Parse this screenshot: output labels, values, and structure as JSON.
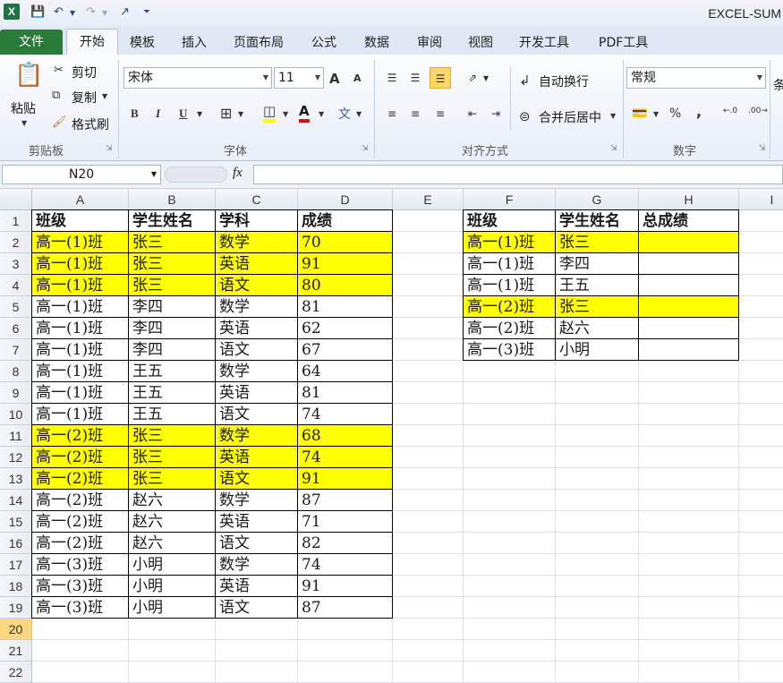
{
  "window": {
    "title": "EXCEL-SUM"
  },
  "tabs": [
    {
      "label": "文件"
    },
    {
      "label": "开始"
    },
    {
      "label": "模板"
    },
    {
      "label": "插入"
    },
    {
      "label": "页面布局"
    },
    {
      "label": "公式"
    },
    {
      "label": "数据"
    },
    {
      "label": "审阅"
    },
    {
      "label": "视图"
    },
    {
      "label": "开发工具"
    },
    {
      "label": "PDF工具"
    }
  ],
  "ribbon": {
    "clipboard": {
      "paste": "粘贴",
      "cut": "剪切",
      "copy": "复制",
      "format_painter": "格式刷",
      "group": "剪贴板"
    },
    "font": {
      "family": "宋体",
      "size": "11",
      "bold": "B",
      "italic": "I",
      "underline": "U",
      "font_color": "A",
      "grow": "A",
      "shrink": "A",
      "group": "字体"
    },
    "alignment": {
      "wrap": "自动换行",
      "merge": "合并后居中",
      "group": "对齐方式"
    },
    "number": {
      "format": "常规",
      "percent": "%",
      "comma": ",",
      "group": "数字",
      "cut_off": "条"
    }
  },
  "formula_bar": {
    "name_box": "N20",
    "fx": "fx",
    "formula": ""
  },
  "columns": [
    "A",
    "B",
    "C",
    "D",
    "E",
    "F",
    "G",
    "H",
    "I"
  ],
  "rows": [
    "1",
    "2",
    "3",
    "4",
    "5",
    "6",
    "7",
    "8",
    "9",
    "10",
    "11",
    "12",
    "13",
    "14",
    "15",
    "16",
    "17",
    "18",
    "19",
    "20",
    "21",
    "22"
  ],
  "selected_row": "20",
  "table_left": {
    "headers": [
      "班级",
      "学生姓名",
      "学科",
      "成绩"
    ],
    "rows": [
      [
        "高一(1)班",
        "张三",
        "数学",
        "70"
      ],
      [
        "高一(1)班",
        "张三",
        "英语",
        "91"
      ],
      [
        "高一(1)班",
        "张三",
        "语文",
        "80"
      ],
      [
        "高一(1)班",
        "李四",
        "数学",
        "81"
      ],
      [
        "高一(1)班",
        "李四",
        "英语",
        "62"
      ],
      [
        "高一(1)班",
        "李四",
        "语文",
        "67"
      ],
      [
        "高一(1)班",
        "王五",
        "数学",
        "64"
      ],
      [
        "高一(1)班",
        "王五",
        "英语",
        "81"
      ],
      [
        "高一(1)班",
        "王五",
        "语文",
        "74"
      ],
      [
        "高一(2)班",
        "张三",
        "数学",
        "68"
      ],
      [
        "高一(2)班",
        "张三",
        "英语",
        "74"
      ],
      [
        "高一(2)班",
        "张三",
        "语文",
        "91"
      ],
      [
        "高一(2)班",
        "赵六",
        "数学",
        "87"
      ],
      [
        "高一(2)班",
        "赵六",
        "英语",
        "71"
      ],
      [
        "高一(2)班",
        "赵六",
        "语文",
        "82"
      ],
      [
        "高一(3)班",
        "小明",
        "数学",
        "74"
      ],
      [
        "高一(3)班",
        "小明",
        "英语",
        "91"
      ],
      [
        "高一(3)班",
        "小明",
        "语文",
        "87"
      ]
    ],
    "highlighted_rows": [
      0,
      1,
      2,
      9,
      10,
      11
    ]
  },
  "table_right": {
    "headers": [
      "班级",
      "学生姓名",
      "总成绩"
    ],
    "rows": [
      [
        "高一(1)班",
        "张三",
        ""
      ],
      [
        "高一(1)班",
        "李四",
        ""
      ],
      [
        "高一(1)班",
        "王五",
        ""
      ],
      [
        "高一(2)班",
        "张三",
        ""
      ],
      [
        "高一(2)班",
        "赵六",
        ""
      ],
      [
        "高一(3)班",
        "小明",
        ""
      ]
    ],
    "highlighted_rows": [
      0,
      3
    ]
  },
  "colors": {
    "highlight": "#ffff00",
    "file_tab": "#2a7a3a",
    "active_row_header": "#f9d77e"
  }
}
